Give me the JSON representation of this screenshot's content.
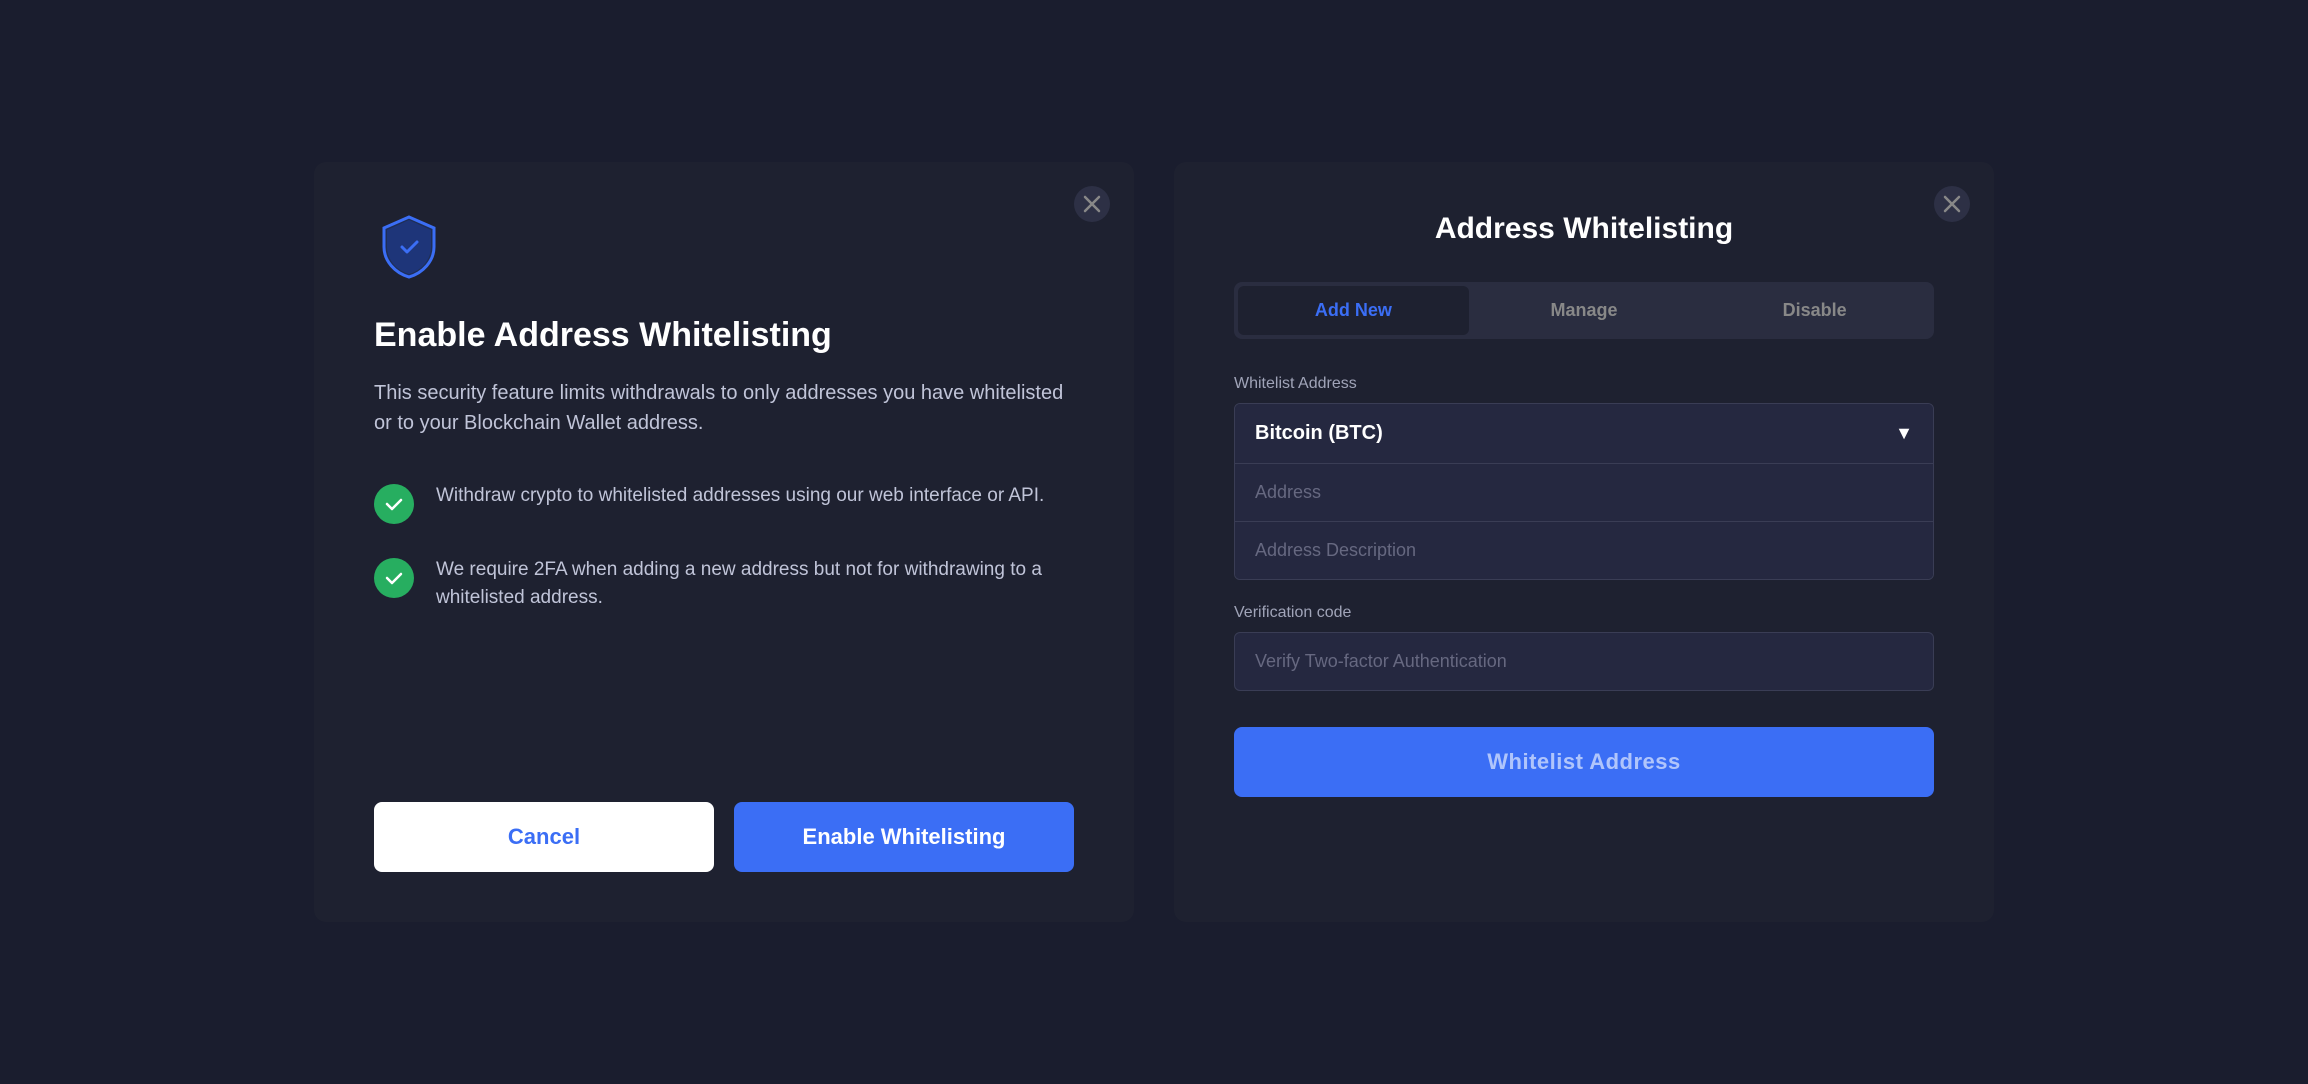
{
  "left_modal": {
    "title": "Enable Address Whitelisting",
    "description": "This security feature limits withdrawals to only addresses you have whitelisted or to your Blockchain Wallet address.",
    "features": [
      {
        "id": "feature-1",
        "text": "Withdraw crypto to whitelisted addresses using our web interface or API."
      },
      {
        "id": "feature-2",
        "text": "We require 2FA when adding a new address but not for withdrawing to a whitelisted address."
      }
    ],
    "cancel_label": "Cancel",
    "enable_label": "Enable Whitelisting",
    "close_label": "×"
  },
  "right_modal": {
    "title": "Address Whitelisting",
    "tabs": [
      {
        "id": "add-new",
        "label": "Add New",
        "active": true
      },
      {
        "id": "manage",
        "label": "Manage",
        "active": false
      },
      {
        "id": "disable",
        "label": "Disable",
        "active": false
      }
    ],
    "whitelist_address_label": "Whitelist Address",
    "selected_currency": "Bitcoin (BTC)",
    "address_placeholder": "Address",
    "address_description_placeholder": "Address Description",
    "verification_label": "Verification code",
    "verification_placeholder": "Verify Two-factor Authentication",
    "submit_label": "Whitelist Address",
    "close_label": "×"
  },
  "icons": {
    "shield": "shield",
    "check": "check",
    "close": "close",
    "chevron_down": "chevron-down"
  }
}
